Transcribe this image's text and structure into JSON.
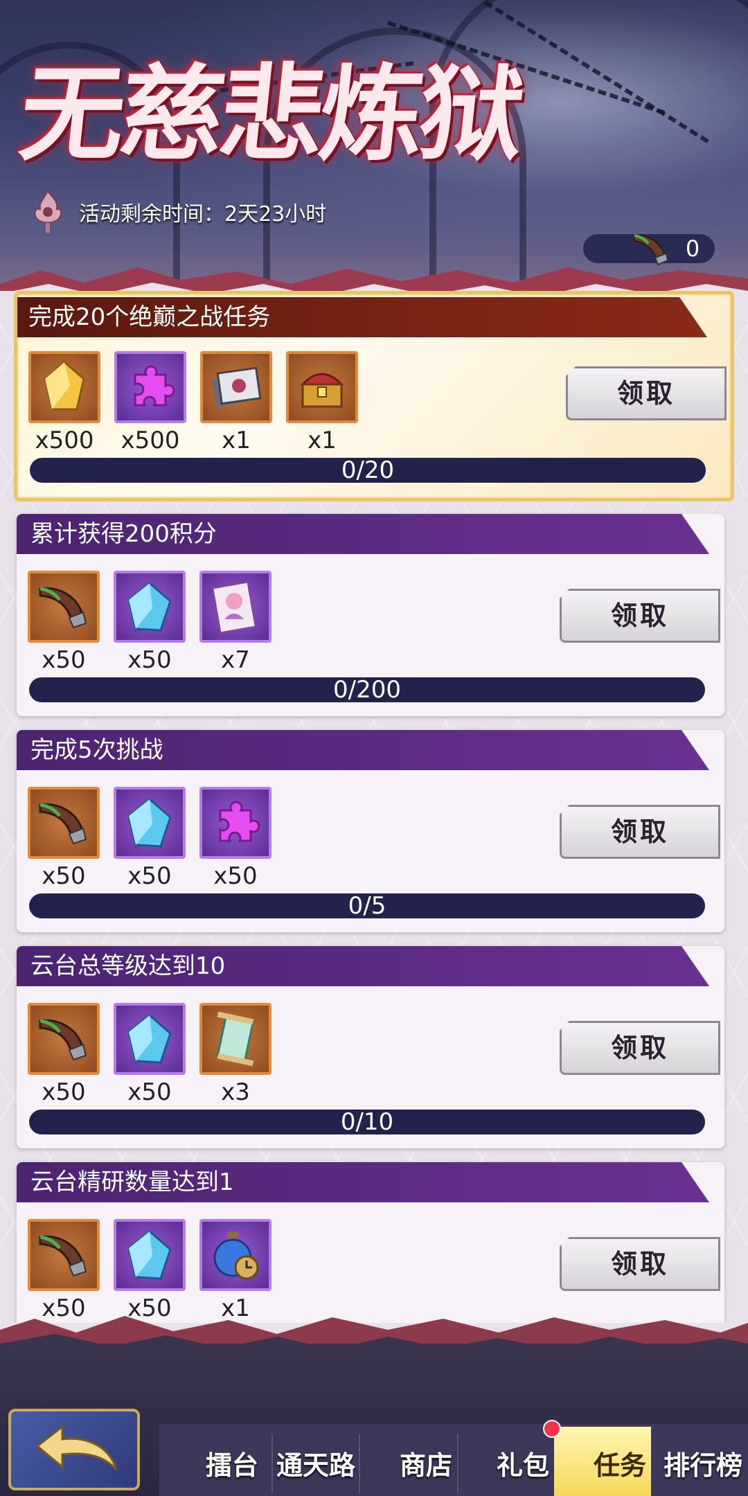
{
  "event": {
    "title": "无慈悲炼狱",
    "timer_label": "活动剩余时间：",
    "timer_value": "2天23小时",
    "currency_value": "0"
  },
  "tasks": [
    {
      "title": "完成20个绝巅之战任务",
      "style": "highlight",
      "rewards": [
        {
          "icon": "gold-crystal-icon",
          "frame": "orange",
          "qty": "x500"
        },
        {
          "icon": "purple-puzzle-icon",
          "frame": "purple",
          "qty": "x500"
        },
        {
          "icon": "card-stack-icon",
          "frame": "orange",
          "qty": "x1"
        },
        {
          "icon": "treasure-chest-icon",
          "frame": "orange",
          "qty": "x1"
        }
      ],
      "claim_label": "领取",
      "progress_text": "0/20",
      "progress_fraction": 0
    },
    {
      "title": "累计获得200积分",
      "style": "normal",
      "rewards": [
        {
          "icon": "horn-icon",
          "frame": "orange",
          "qty": "x50"
        },
        {
          "icon": "blue-crystal-icon",
          "frame": "purple",
          "qty": "x50"
        },
        {
          "icon": "character-card-icon",
          "frame": "purple",
          "qty": "x7"
        }
      ],
      "claim_label": "领取",
      "progress_text": "0/200",
      "progress_fraction": 0
    },
    {
      "title": "完成5次挑战",
      "style": "normal",
      "rewards": [
        {
          "icon": "horn-icon",
          "frame": "orange",
          "qty": "x50"
        },
        {
          "icon": "blue-crystal-icon",
          "frame": "purple",
          "qty": "x50"
        },
        {
          "icon": "purple-puzzle-icon",
          "frame": "purple",
          "qty": "x50"
        }
      ],
      "claim_label": "领取",
      "progress_text": "0/5",
      "progress_fraction": 0
    },
    {
      "title": "云台总等级达到10",
      "style": "normal",
      "rewards": [
        {
          "icon": "horn-icon",
          "frame": "orange",
          "qty": "x50"
        },
        {
          "icon": "blue-crystal-icon",
          "frame": "purple",
          "qty": "x50"
        },
        {
          "icon": "scroll-icon",
          "frame": "orange",
          "qty": "x3"
        }
      ],
      "claim_label": "领取",
      "progress_text": "0/10",
      "progress_fraction": 0
    },
    {
      "title": "云台精研数量达到1",
      "style": "normal",
      "rewards": [
        {
          "icon": "horn-icon",
          "frame": "orange",
          "qty": "x50"
        },
        {
          "icon": "blue-crystal-icon",
          "frame": "purple",
          "qty": "x50"
        },
        {
          "icon": "potion-clock-icon",
          "frame": "purple",
          "qty": "x1"
        }
      ],
      "claim_label": "领取"
    }
  ],
  "tabs": [
    {
      "label": "擂台",
      "active": false
    },
    {
      "label": "通天路",
      "active": false
    },
    {
      "label": "商店",
      "active": false
    },
    {
      "label": "礼包",
      "active": false,
      "notification": true
    },
    {
      "label": "任务",
      "active": true
    },
    {
      "label": "排行榜",
      "active": false
    }
  ],
  "colors": {
    "card_title_purple": "#5e2c86",
    "highlight_title_red": "#7a2414",
    "progress_track": "#23224d",
    "highlight_border": "#e9c46a",
    "active_tab": "#f5d85a",
    "notification_dot": "#f2334a"
  }
}
